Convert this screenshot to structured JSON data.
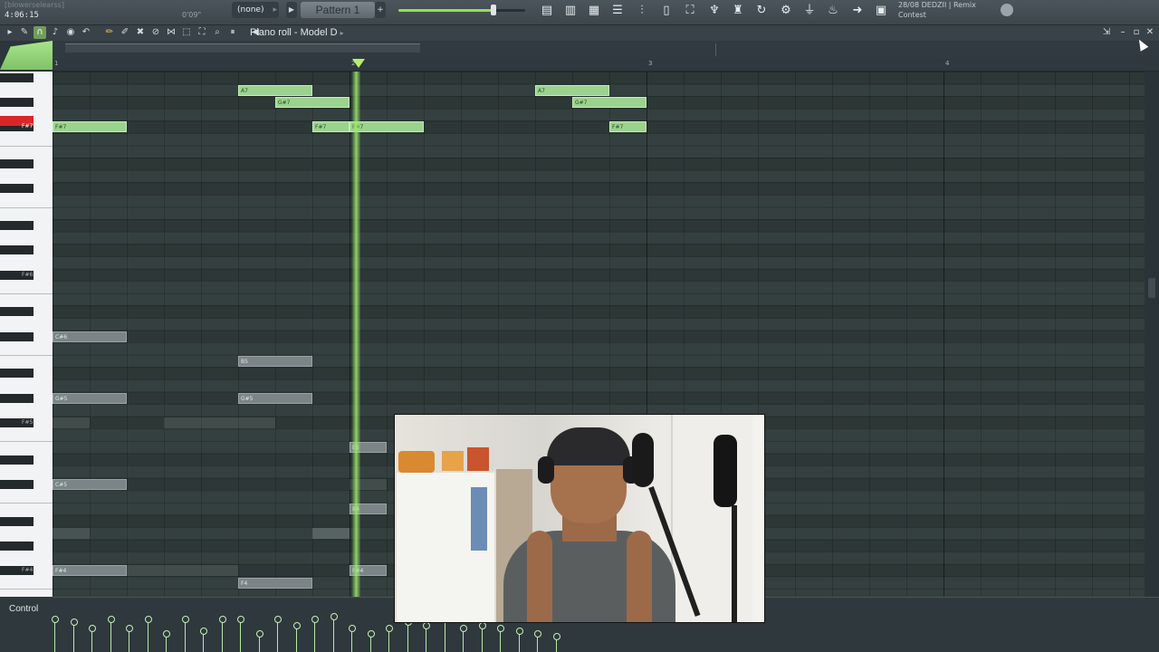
{
  "toolbar": {
    "hint_text": "[blowerselearss]",
    "time": "4:06:15",
    "cpu": "0'09\"",
    "pattern_select": "(none)",
    "pattern_name": "Pattern 1",
    "pattern_add": "+",
    "master_volume": 0.76,
    "news_line1": "28/08  DEDZII | Remix",
    "news_line2": "Contest",
    "icons": [
      "mixer-icon",
      "piano-icon",
      "channel-rack-icon",
      "playlist-icon",
      "plugin-icon",
      "browser-icon",
      "tempo-icon",
      "plugin-picker-icon",
      "stamp-icon",
      "undo-history-icon",
      "cpu-icon",
      "mic-icon",
      "audio-input-icon",
      "arrow-icon",
      "settings-icon"
    ]
  },
  "piano_roll": {
    "title": "Piano roll - Model D",
    "tools": [
      "play-icon",
      "wrench-icon",
      "magnet-icon",
      "metronome-icon",
      "record-icon",
      "undo-icon",
      "pencil-icon",
      "paint-icon",
      "delete-icon",
      "mute-icon",
      "slice-icon",
      "select-icon",
      "zoom-icon",
      "playback-icon",
      "speaker-icon"
    ],
    "bar_numbers": [
      "1",
      "2",
      "3",
      "4"
    ],
    "control_label": "Control"
  },
  "keyboard": {
    "labels": [
      "F#7",
      "F#6",
      "F#5",
      "F#4"
    ]
  },
  "notes": [
    {
      "label": "A7",
      "row": 1,
      "start": 5,
      "len": 2,
      "kind": "green"
    },
    {
      "label": "G#7",
      "row": 2,
      "start": 6,
      "len": 2,
      "kind": "green"
    },
    {
      "label": "F#7",
      "row": 4,
      "start": 0,
      "len": 2,
      "kind": "green"
    },
    {
      "label": "F#7",
      "row": 4,
      "start": 7,
      "len": 1,
      "kind": "green"
    },
    {
      "label": "F#7",
      "row": 4,
      "start": 8,
      "len": 2,
      "kind": "green"
    },
    {
      "label": "A7",
      "row": 1,
      "start": 13,
      "len": 2,
      "kind": "green"
    },
    {
      "label": "G#7",
      "row": 2,
      "start": 14,
      "len": 2,
      "kind": "green"
    },
    {
      "label": "F#7",
      "row": 4,
      "start": 15,
      "len": 1,
      "kind": "green"
    },
    {
      "label": "C#6",
      "row": 21,
      "start": 0,
      "len": 2,
      "kind": "gray"
    },
    {
      "label": "B5",
      "row": 23,
      "start": 5,
      "len": 2,
      "kind": "gray"
    },
    {
      "label": "G#5",
      "row": 26,
      "start": 0,
      "len": 2,
      "kind": "gray"
    },
    {
      "label": "G#5",
      "row": 26,
      "start": 5,
      "len": 2,
      "kind": "gray"
    },
    {
      "label": "E5",
      "row": 30,
      "start": 8,
      "len": 1,
      "kind": "gray"
    },
    {
      "label": "C#5",
      "row": 33,
      "start": 0,
      "len": 2,
      "kind": "gray"
    },
    {
      "label": "B4",
      "row": 35,
      "start": 8,
      "len": 1,
      "kind": "gray"
    },
    {
      "label": "F#4",
      "row": 40,
      "start": 0,
      "len": 2,
      "kind": "gray"
    },
    {
      "label": "F#4",
      "row": 40,
      "start": 8,
      "len": 1,
      "kind": "gray"
    },
    {
      "label": "F4",
      "row": 41,
      "start": 5,
      "len": 2,
      "kind": "gray"
    }
  ],
  "velocities": [
    0.6,
    0.55,
    0.45,
    0.6,
    0.45,
    0.6,
    0.35,
    0.6,
    0.4,
    0.6,
    0.6,
    0.35,
    0.6,
    0.5,
    0.6,
    0.65,
    0.45,
    0.35,
    0.45,
    0.55,
    0.5,
    0.6,
    0.45,
    0.5,
    0.45,
    0.4,
    0.35,
    0.3
  ]
}
